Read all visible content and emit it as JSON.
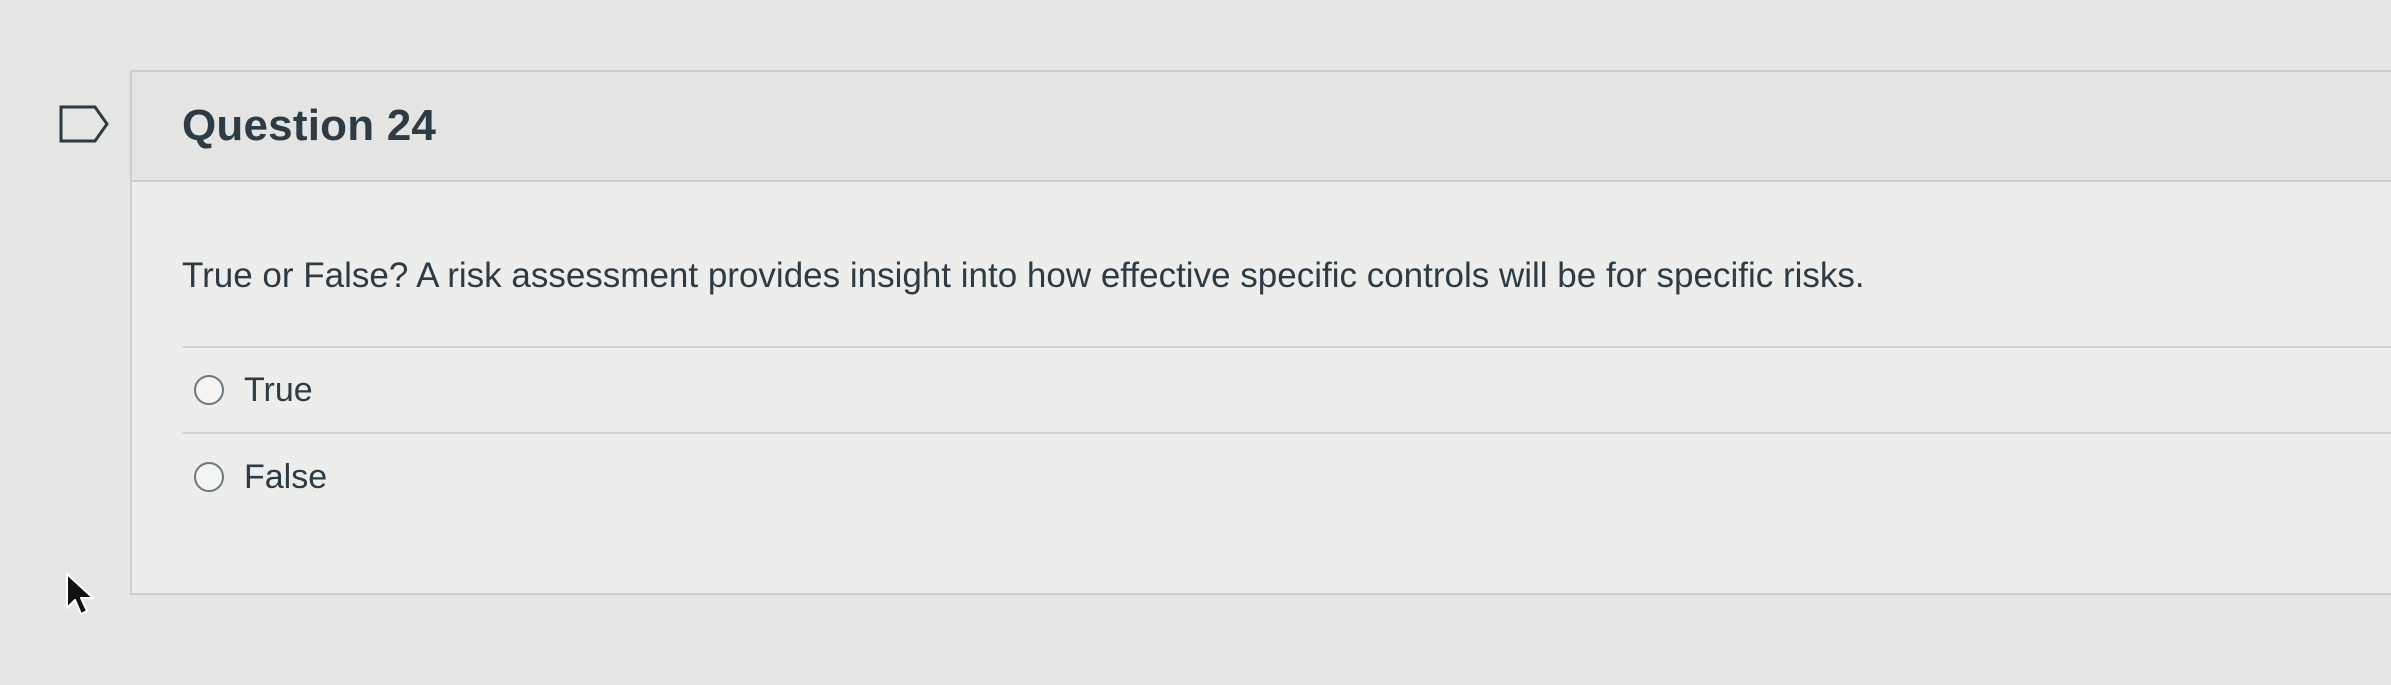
{
  "question": {
    "title": "Question 24",
    "text": "True or False? A risk assessment provides insight into how effective specific controls will be for specific risks.",
    "answers": [
      {
        "label": "True",
        "selected": false
      },
      {
        "label": "False",
        "selected": false
      }
    ]
  },
  "icons": {
    "flag": "flag-question-icon",
    "cursor": "mouse-pointer-icon"
  },
  "colors": {
    "text": "#2d3b45",
    "border": "#c7cdd1",
    "background": "#e6e6e4"
  }
}
